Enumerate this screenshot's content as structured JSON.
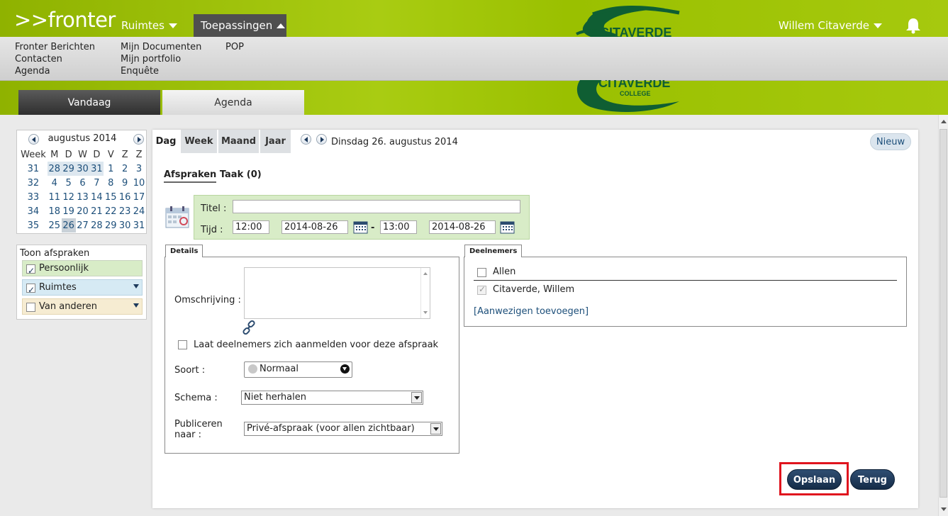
{
  "header": {
    "logo": ">>fronter",
    "nav": [
      {
        "label": "Ruimtes"
      },
      {
        "label": "Toepassingen"
      }
    ],
    "user": "Willem Citaverde",
    "brand_text": "CITAVERDE",
    "brand_sub": "COLLEGE"
  },
  "submenu": {
    "col1": [
      "Fronter Berichten",
      "Contacten",
      "Agenda"
    ],
    "col2": [
      "Mijn Documenten",
      "Mijn portfolio",
      "Enquête"
    ],
    "col3": [
      "POP"
    ]
  },
  "band_tabs": {
    "today": "Vandaag",
    "agenda": "Agenda"
  },
  "mini_calendar": {
    "month": "augustus 2014",
    "headers": [
      "Week",
      "M",
      "D",
      "W",
      "D",
      "V",
      "Z",
      "Z"
    ],
    "weeks": [
      {
        "week": "31",
        "days": [
          "28",
          "29",
          "30",
          "31",
          "1",
          "2",
          "3"
        ]
      },
      {
        "week": "32",
        "days": [
          "4",
          "5",
          "6",
          "7",
          "8",
          "9",
          "10"
        ]
      },
      {
        "week": "33",
        "days": [
          "11",
          "12",
          "13",
          "14",
          "15",
          "16",
          "17"
        ]
      },
      {
        "week": "34",
        "days": [
          "18",
          "19",
          "20",
          "21",
          "22",
          "23",
          "24"
        ]
      },
      {
        "week": "35",
        "days": [
          "25",
          "26",
          "27",
          "28",
          "29",
          "30",
          "31"
        ]
      }
    ]
  },
  "filters": {
    "title": "Toon afspraken",
    "items": [
      {
        "label": "Persoonlijk",
        "checked": true,
        "color": "#d8ecc7"
      },
      {
        "label": "Ruimtes",
        "checked": true,
        "color": "#d6eaf4"
      },
      {
        "label": "Van anderen",
        "checked": false,
        "color": "#f6ecd2"
      }
    ]
  },
  "view_tabs": [
    "Dag",
    "Week",
    "Maand",
    "Jaar"
  ],
  "current_date": "Dinsdag 26. augustus 2014",
  "new_button": "Nieuw",
  "subtabs": {
    "afspraken": "Afspraken",
    "taak": "Taak (0)"
  },
  "form": {
    "titel_label": "Titel :",
    "titel_value": "",
    "tijd_label": "Tijd :",
    "start_time": "12:00",
    "start_date": "2014-08-26",
    "separator": "-",
    "end_time": "13:00",
    "end_date": "2014-08-26"
  },
  "details": {
    "tab": "Details",
    "omschrijving_label": "Omschrijving :",
    "omschrijving_value": "",
    "checkbox_label": "Laat deelnemers zich aanmelden voor deze afspraak",
    "soort_label": "Soort :",
    "soort_value": "Normaal",
    "schema_label": "Schema :",
    "schema_value": "Niet herhalen",
    "publiceren_label_1": "Publiceren",
    "publiceren_label_2": "naar :",
    "publiceren_value": "Privé-afspraak (voor allen zichtbaar)"
  },
  "deelnemers": {
    "tab": "Deelnemers",
    "all": "Allen",
    "person": "Citaverde, Willem",
    "add_link": "[Aanwezigen toevoegen]"
  },
  "actions": {
    "save": "Opslaan",
    "back": "Terug"
  },
  "colors": {
    "accent_green": "#a6c90e",
    "button_navy": "#1e3a5c",
    "highlight": "#e0141e"
  }
}
